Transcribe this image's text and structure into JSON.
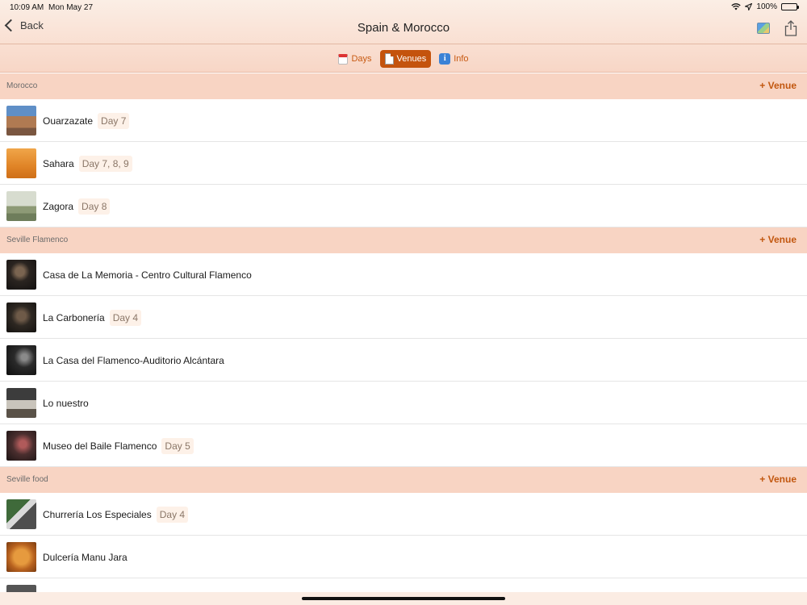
{
  "status": {
    "time": "10:09 AM",
    "date": "Mon May 27",
    "battery": "100%"
  },
  "nav": {
    "back_label": "Back",
    "title": "Spain & Morocco"
  },
  "segments": [
    {
      "label": "Days",
      "icon": "calendar-icon",
      "active": false
    },
    {
      "label": "Venues",
      "icon": "document-icon",
      "active": true
    },
    {
      "label": "Info",
      "icon": "info-icon",
      "active": false
    }
  ],
  "colors": {
    "accent": "#c4530d",
    "header_bg": "#f8d4c3"
  },
  "sections": [
    {
      "name": "Morocco",
      "add_label": "+ Venue",
      "venues": [
        {
          "name": "Ouarzazate",
          "days": "Day 7",
          "thumb": "kasbah-photo"
        },
        {
          "name": "Sahara",
          "days": "Day 7, 8, 9",
          "thumb": "desert-photo"
        },
        {
          "name": "Zagora",
          "days": "Day 8",
          "thumb": "valley-photo"
        }
      ]
    },
    {
      "name": "Seville Flamenco",
      "add_label": "+ Venue",
      "venues": [
        {
          "name": "Casa de La Memoria - Centro Cultural Flamenco",
          "days": "",
          "thumb": "stage-photo"
        },
        {
          "name": "La Carbonería",
          "days": "Day 4",
          "thumb": "bar-photo"
        },
        {
          "name": "La Casa del Flamenco-Auditorio Alcántara",
          "days": "",
          "thumb": "stage-photo"
        },
        {
          "name": "Lo nuestro",
          "days": "",
          "thumb": "tables-photo"
        },
        {
          "name": "Museo del Baile Flamenco",
          "days": "Day 5",
          "thumb": "dancer-photo"
        }
      ]
    },
    {
      "name": "Seville food",
      "add_label": "+ Venue",
      "venues": [
        {
          "name": "Churrería Los Especiales",
          "days": "Day 4",
          "thumb": "street-photo"
        },
        {
          "name": "Dulcería Manu Jara",
          "days": "",
          "thumb": "pastry-photo"
        }
      ]
    }
  ]
}
